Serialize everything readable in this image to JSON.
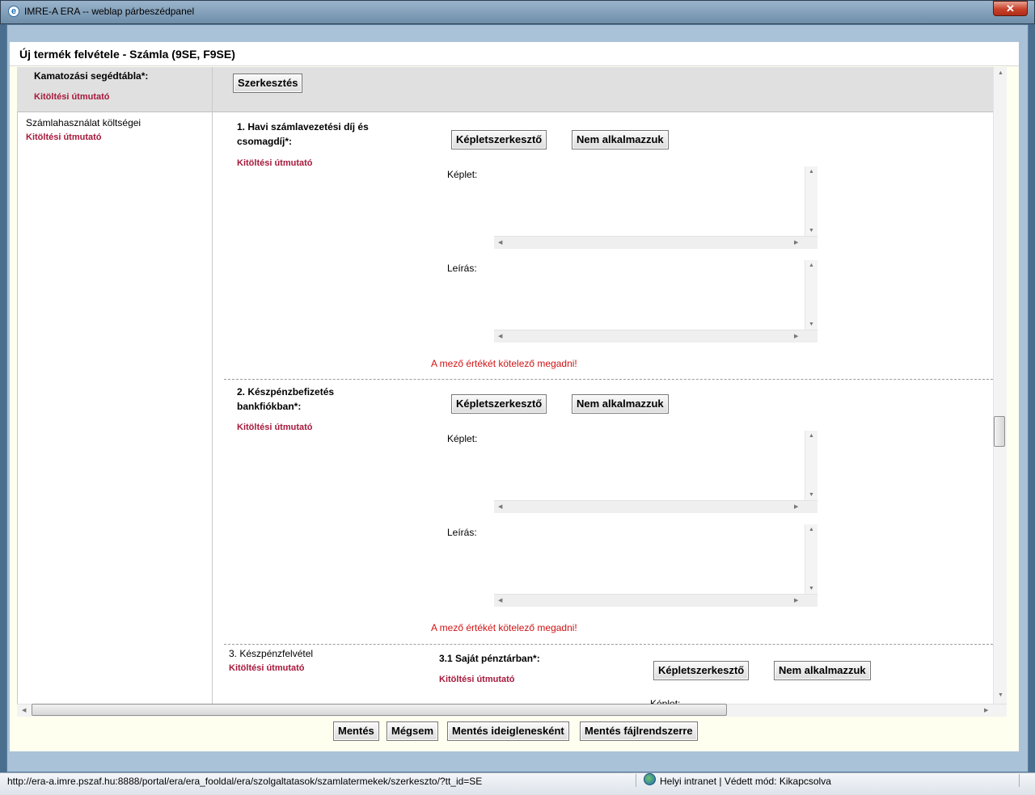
{
  "window": {
    "title": "IMRE-A ERA -- weblap párbeszédpanel",
    "close_label": "✕"
  },
  "header": {
    "title": "Új termék felvétele - Számla (9SE, F9SE)"
  },
  "guide_label": "Kitöltési útmutató",
  "kamatozasi": {
    "label": "Kamatozási segédtábla*:",
    "button": "Szerkesztés"
  },
  "szamlahasznalat": {
    "label": "Számlahasználat költségei"
  },
  "buttons": {
    "formula_editor": "Képletszerkesztő",
    "not_applied": "Nem alkalmazzuk"
  },
  "field_labels": {
    "formula": "Képlet:",
    "description": "Leírás:"
  },
  "error_text": "A mező értékét kötelező megadni!",
  "items": [
    {
      "title_line1": "1. Havi számlavezetési díj és",
      "title_line2": "csomagdíj*:"
    },
    {
      "title_line1": "2. Készpénzbefizetés",
      "title_line2": "bankfiókban*:"
    },
    {
      "title": "3. Készpénzfelvétel",
      "sub_title": "3.1 Saját pénztárban*:",
      "partial_label": "Képlet:"
    }
  ],
  "footer": {
    "save": "Mentés",
    "cancel": "Mégsem",
    "save_temp": "Mentés ideiglenesként",
    "save_fs": "Mentés fájlrendszerre"
  },
  "status": {
    "url": "http://era-a.imre.pszaf.hu:8888/portal/era/era_fooldal/era/szolgaltatasok/szamlatermekek/szerkeszto/?tt_id=SE",
    "zone": "Helyi intranet | Védett mód: Kikapcsolva"
  },
  "icons": {
    "window_icon": "ie-icon",
    "zone_icon": "globe-icon"
  },
  "colors": {
    "guide": "#a6193b",
    "error": "#d11212",
    "accent": "#4a6e8e"
  }
}
